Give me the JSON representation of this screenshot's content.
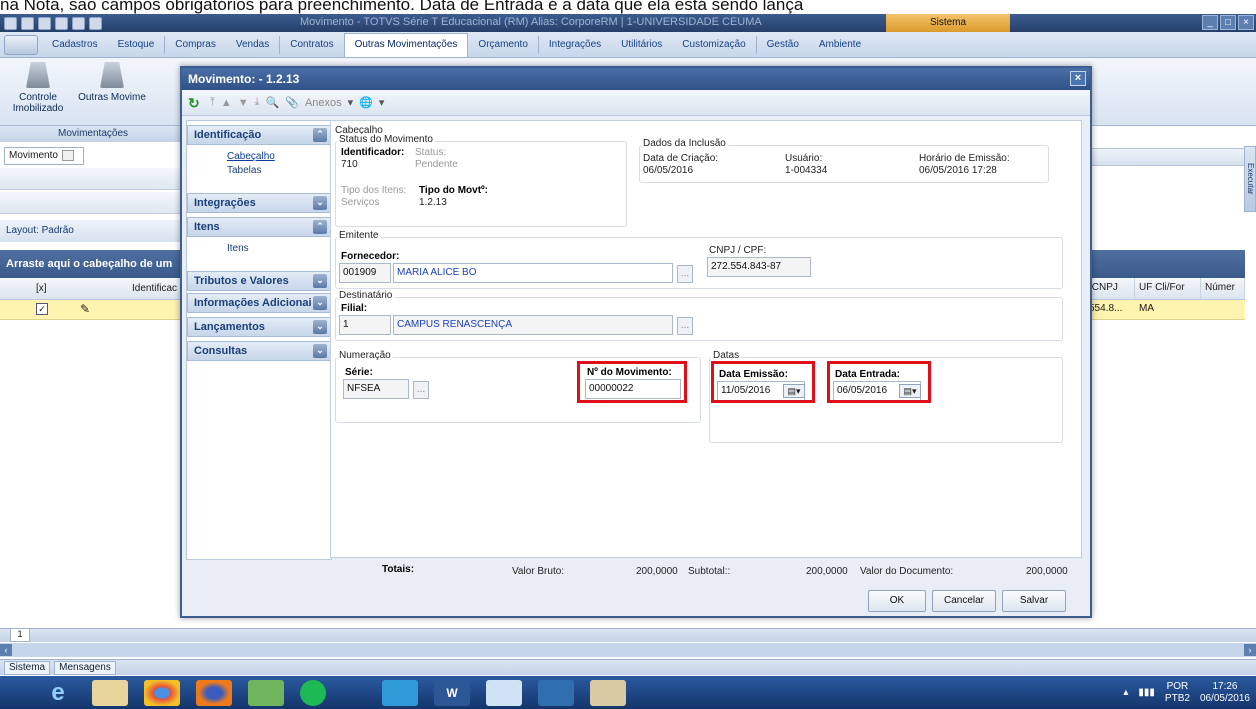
{
  "doc_text": "na Nota, são campos obrigatórios para preenchimento. Data de Entrada é a data que ela está sendo lança",
  "app": {
    "title": "Movimento - TOTVS Série T Educacional (RM) Alias: CorporeRM | 1-UNIVERSIDADE CEUMA",
    "context_tab": "Sistema"
  },
  "menu": [
    "Cadastros",
    "Estoque",
    "Compras",
    "Vendas",
    "Contratos",
    "Outras Movimentações",
    "Orçamento",
    "Integrações",
    "Utilitários",
    "Customização",
    "Gestão",
    "Ambiente"
  ],
  "ribbon": {
    "btn1": "Controle Imobilizado",
    "btn2": "Outras Movime",
    "group_label": "Movimentações"
  },
  "left": {
    "tab": "Movimento",
    "layout_label": "Layout:",
    "layout_value": "Padrão",
    "group_header": "Arraste aqui o cabeçalho de um",
    "col_x": "[x]",
    "col_ident": "Identificac"
  },
  "right": {
    "executar": "Executar",
    "cols": [
      "/CNPJ",
      "UF Cli/For",
      "Númer"
    ],
    "row": [
      "554.8...",
      "MA",
      ""
    ]
  },
  "pager": "1",
  "status_tabs": [
    "Sistema",
    "Mensagens"
  ],
  "tray": {
    "lang1": "POR",
    "lang2": "PTB2",
    "time": "17:26",
    "date": "06/05/2016"
  },
  "dialog": {
    "title": "Movimento: - 1.2.13",
    "anexos": "Anexos",
    "nav": {
      "identificacao": "Identificação",
      "cabecalho": "Cabeçalho",
      "tabelas": "Tabelas",
      "integracoes": "Integrações",
      "itens_hdr": "Itens",
      "itens": "Itens",
      "tributos": "Tributos e Valores",
      "info": "Informações Adicionai",
      "lancamentos": "Lançamentos",
      "consultas": "Consultas"
    },
    "cabecalho_legend": "Cabeçalho",
    "status_legend": "Status do Movimento",
    "identificador_label": "Identificador:",
    "identificador_value": "710",
    "status_label": "Status:",
    "status_value": "Pendente",
    "tipo_itens_label": "Tipo dos Itens:",
    "tipo_itens_value": "Serviços",
    "tipo_movt_label": "Tipo do Movtº:",
    "tipo_movt_value": "1.2.13",
    "inclusao_legend": "Dados da Inclusão",
    "data_criacao_label": "Data de Criação:",
    "data_criacao_value": "06/05/2016",
    "usuario_label": "Usuário:",
    "usuario_value": "1-004334",
    "horario_label": "Horário de Emissão:",
    "horario_value": "06/05/2016 17:28",
    "emitente_legend": "Emitente",
    "fornecedor_label": "Fornecedor:",
    "fornecedor_code": "001909",
    "fornecedor_name": "MARIA ALICE BO",
    "cnpj_label": "CNPJ / CPF:",
    "cnpj_value": "272.554.843-87",
    "destinatario_legend": "Destinatário",
    "filial_label": "Filial:",
    "filial_code": "1",
    "filial_name": "CAMPUS RENASCENÇA",
    "numeracao_legend": "Numeração",
    "serie_label": "Série:",
    "serie_value": "NFSEA",
    "num_mov_label": "Nº do Movimento:",
    "num_mov_value": "00000022",
    "datas_legend": "Datas",
    "data_emissao_label": "Data Emissão:",
    "data_emissao_value": "11/05/2016",
    "data_entrada_label": "Data Entrada:",
    "data_entrada_value": "06/05/2016",
    "totais_label": "Totais:",
    "valor_bruto_label": "Valor Bruto:",
    "valor_bruto_value": "200,0000",
    "subtotal_label": "Subtotal::",
    "subtotal_value": "200,0000",
    "valor_doc_label": "Valor do Documento:",
    "valor_doc_value": "200,0000",
    "btn_ok": "OK",
    "btn_cancelar": "Cancelar",
    "btn_salvar": "Salvar"
  }
}
